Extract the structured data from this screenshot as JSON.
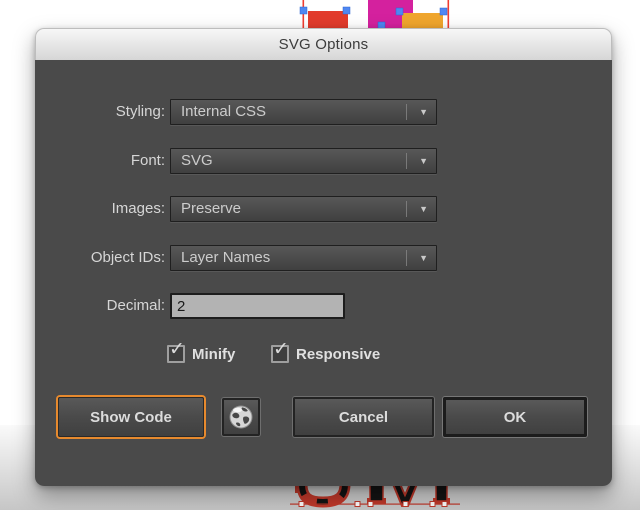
{
  "window": {
    "title": "SVG Options"
  },
  "dialog": {
    "fields": [
      {
        "label": "Styling:",
        "value": "Internal CSS"
      },
      {
        "label": "Font:",
        "value": "SVG"
      },
      {
        "label": "Images:",
        "value": "Preserve"
      },
      {
        "label": "Object IDs:",
        "value": "Layer Names"
      },
      {
        "label": "Decimal:",
        "value": "2"
      }
    ],
    "checkboxes": [
      {
        "label": "Minify",
        "checked": true
      },
      {
        "label": "Responsive",
        "checked": true
      }
    ],
    "buttons": {
      "show_code": "Show Code",
      "cancel": "Cancel",
      "ok": "OK"
    }
  },
  "glyphs": {
    "dropdown_arrow": "▼",
    "check": "✓"
  },
  "colors": {
    "dialog_body": "#4a4a4a",
    "titlebar_top": "#f7f7f7",
    "titlebar_bottom": "#d6d6d6",
    "focus_ring_orange": "#e78a2e",
    "artwork_red": "#e23b2c",
    "artwork_magenta": "#d4219e",
    "artwork_yellow": "#f0a62e",
    "selection_handle_blue": "#4f87f2",
    "guide_red": "#f03c30",
    "glyph_red": "#c0392b",
    "glyph_black": "#141414"
  }
}
